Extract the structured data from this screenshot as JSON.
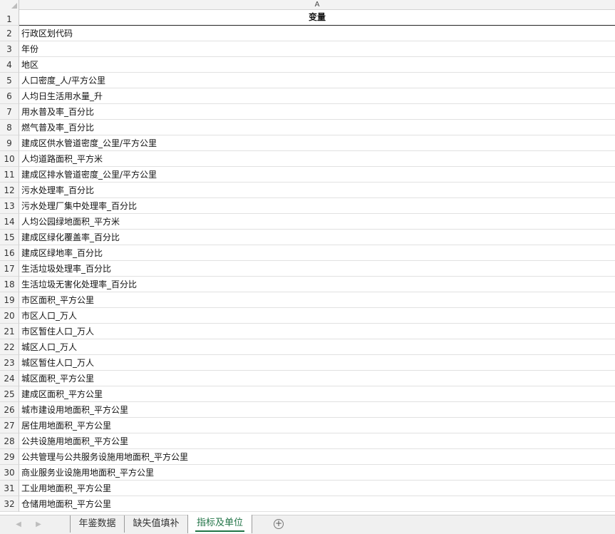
{
  "columns": {
    "a_header": "A"
  },
  "cells": [
    "变量",
    "行政区划代码",
    "年份",
    "地区",
    "人口密度_人/平方公里",
    "人均日生活用水量_升",
    "用水普及率_百分比",
    "燃气普及率_百分比",
    "建成区供水管道密度_公里/平方公里",
    "人均道路面积_平方米",
    "建成区排水管道密度_公里/平方公里",
    "污水处理率_百分比",
    "污水处理厂集中处理率_百分比",
    "人均公园绿地面积_平方米",
    "建成区绿化覆盖率_百分比",
    "建成区绿地率_百分比",
    "生活垃圾处理率_百分比",
    "生活垃圾无害化处理率_百分比",
    "市区面积_平方公里",
    "市区人口_万人",
    "市区暂住人口_万人",
    "城区人口_万人",
    "城区暂住人口_万人",
    "城区面积_平方公里",
    "建成区面积_平方公里",
    "城市建设用地面积_平方公里",
    "居住用地面积_平方公里",
    "公共设施用地面积_平方公里",
    "公共管理与公共服务设施用地面积_平方公里",
    "商业服务业设施用地面积_平方公里",
    "工业用地面积_平方公里",
    "仓储用地面积_平方公里"
  ],
  "row_numbers": [
    "1",
    "2",
    "3",
    "4",
    "5",
    "6",
    "7",
    "8",
    "9",
    "10",
    "11",
    "12",
    "13",
    "14",
    "15",
    "16",
    "17",
    "18",
    "19",
    "20",
    "21",
    "22",
    "23",
    "24",
    "25",
    "26",
    "27",
    "28",
    "29",
    "30",
    "31",
    "32"
  ],
  "tabs": {
    "nav_prev": "◀",
    "nav_next": "▶",
    "items": [
      "年鉴数据",
      "缺失值填补",
      "指标及单位"
    ],
    "active_index": 2,
    "add_label": "+"
  },
  "colors": {
    "active_tab": "#217346",
    "header_bg": "#f3f3f3"
  }
}
